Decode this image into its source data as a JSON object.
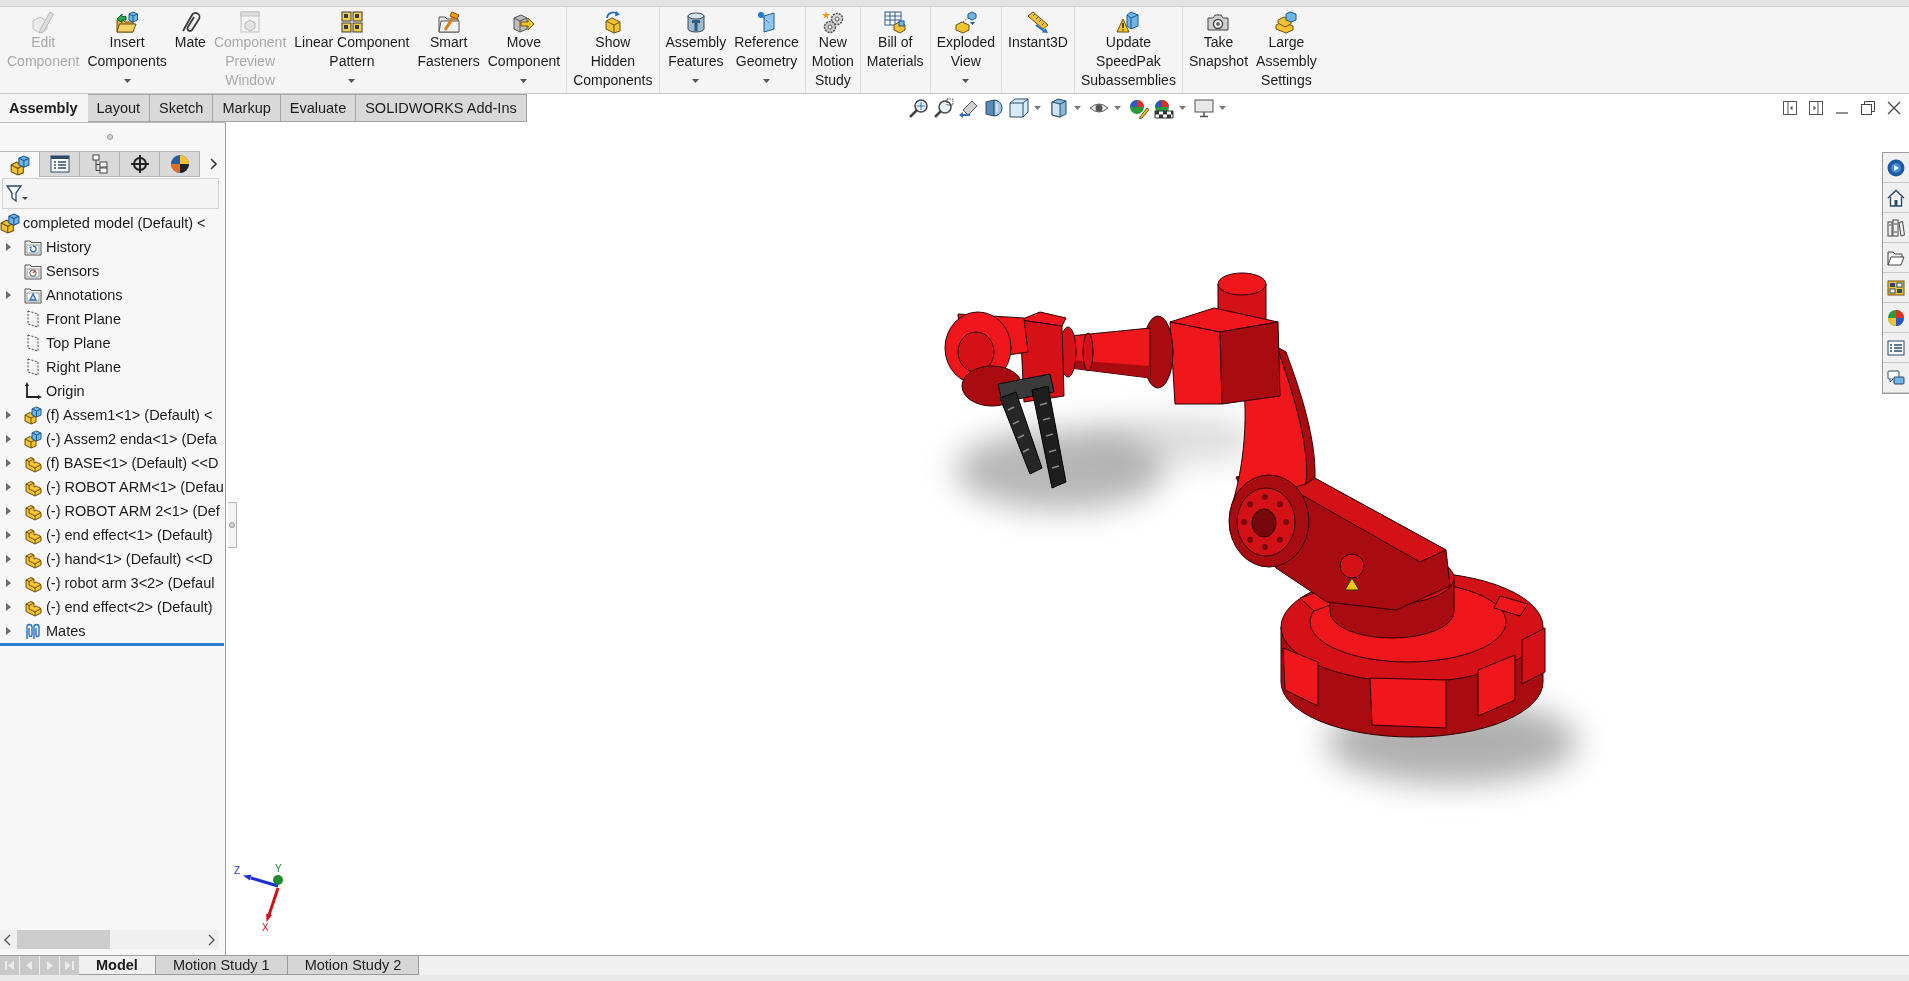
{
  "command_manager": {
    "groups": [
      {
        "buttons": [
          {
            "label": [
              "Edit",
              "Component"
            ],
            "disabled": true,
            "dropdown": false
          },
          {
            "label": [
              "Insert",
              "Components"
            ],
            "disabled": false,
            "dropdown": true
          },
          {
            "label": [
              "Mate"
            ],
            "disabled": false,
            "dropdown": false
          },
          {
            "label": [
              "Component",
              "Preview",
              "Window"
            ],
            "disabled": true,
            "dropdown": false
          },
          {
            "label": [
              "Linear Component",
              "Pattern"
            ],
            "disabled": false,
            "dropdown": true
          },
          {
            "label": [
              "Smart",
              "Fasteners"
            ],
            "disabled": false,
            "dropdown": false
          },
          {
            "label": [
              "Move",
              "Component"
            ],
            "disabled": false,
            "dropdown": true
          }
        ]
      },
      {
        "buttons": [
          {
            "label": [
              "Show",
              "Hidden",
              "Components"
            ],
            "disabled": false,
            "dropdown": false
          }
        ]
      },
      {
        "buttons": [
          {
            "label": [
              "Assembly",
              "Features"
            ],
            "disabled": false,
            "dropdown": true
          },
          {
            "label": [
              "Reference",
              "Geometry"
            ],
            "disabled": false,
            "dropdown": true
          }
        ]
      },
      {
        "buttons": [
          {
            "label": [
              "New",
              "Motion",
              "Study"
            ],
            "disabled": false,
            "dropdown": false
          }
        ]
      },
      {
        "buttons": [
          {
            "label": [
              "Bill of",
              "Materials"
            ],
            "disabled": false,
            "dropdown": false
          }
        ]
      },
      {
        "buttons": [
          {
            "label": [
              "Exploded",
              "View"
            ],
            "disabled": false,
            "dropdown": true
          }
        ]
      },
      {
        "buttons": [
          {
            "label": [
              "Instant3D"
            ],
            "disabled": false,
            "dropdown": false
          }
        ]
      },
      {
        "buttons": [
          {
            "label": [
              "Update",
              "SpeedPak",
              "Subassemblies"
            ],
            "disabled": false,
            "dropdown": false
          }
        ]
      },
      {
        "buttons": [
          {
            "label": [
              "Take",
              "Snapshot"
            ],
            "disabled": false,
            "dropdown": false
          },
          {
            "label": [
              "Large",
              "Assembly",
              "Settings"
            ],
            "disabled": false,
            "dropdown": false
          }
        ]
      }
    ]
  },
  "command_tabs": [
    {
      "label": "Assembly",
      "selected": true
    },
    {
      "label": "Layout",
      "selected": false
    },
    {
      "label": "Sketch",
      "selected": false
    },
    {
      "label": "Markup",
      "selected": false
    },
    {
      "label": "Evaluate",
      "selected": false
    },
    {
      "label": "SOLIDWORKS Add-Ins",
      "selected": false
    }
  ],
  "feature_manager": {
    "tabs": [
      {
        "selected": true
      },
      {
        "selected": false
      },
      {
        "selected": false
      },
      {
        "selected": false
      },
      {
        "selected": false
      }
    ],
    "tree": {
      "label": "completed model (Default) <",
      "kind": "assembly",
      "children": [
        {
          "label": "History",
          "kind": "history",
          "expandable": true
        },
        {
          "label": "Sensors",
          "kind": "sensors",
          "expandable": false
        },
        {
          "label": "Annotations",
          "kind": "annotations",
          "expandable": true
        },
        {
          "label": "Front Plane",
          "kind": "plane",
          "expandable": false
        },
        {
          "label": "Top Plane",
          "kind": "plane",
          "expandable": false
        },
        {
          "label": "Right Plane",
          "kind": "plane",
          "expandable": false
        },
        {
          "label": "Origin",
          "kind": "origin",
          "expandable": false
        },
        {
          "label": "(f) Assem1<1> (Default) <",
          "kind": "assembly",
          "expandable": true
        },
        {
          "label": "(-) Assem2 enda<1> (Defa",
          "kind": "assembly",
          "expandable": true
        },
        {
          "label": "(f) BASE<1> (Default) <<D",
          "kind": "part",
          "expandable": true
        },
        {
          "label": "(-) ROBOT ARM<1> (Defau",
          "kind": "part",
          "expandable": true
        },
        {
          "label": "(-) ROBOT ARM 2<1> (Def",
          "kind": "part",
          "expandable": true
        },
        {
          "label": "(-) end effect<1> (Default)",
          "kind": "part",
          "expandable": true
        },
        {
          "label": "(-) hand<1> (Default) <<D",
          "kind": "part",
          "expandable": true
        },
        {
          "label": "(-) robot arm 3<2> (Defaul",
          "kind": "part",
          "expandable": true
        },
        {
          "label": "(-) end effect<2> (Default)",
          "kind": "part",
          "expandable": true
        },
        {
          "label": "Mates",
          "kind": "mates",
          "expandable": true
        }
      ]
    }
  },
  "viewport": {
    "triad": [
      {
        "label": "Z",
        "kind": "arrow",
        "color": "#1c2fd6"
      },
      {
        "label": "Y",
        "kind": "point",
        "color": "#1e8a2e"
      },
      {
        "label": "X",
        "kind": "arrow",
        "color": "#c8141c"
      }
    ]
  },
  "bottom_tabs": [
    {
      "label": "Model",
      "selected": true
    },
    {
      "label": "Motion Study 1",
      "selected": false
    },
    {
      "label": "Motion Study 2",
      "selected": false
    }
  ]
}
